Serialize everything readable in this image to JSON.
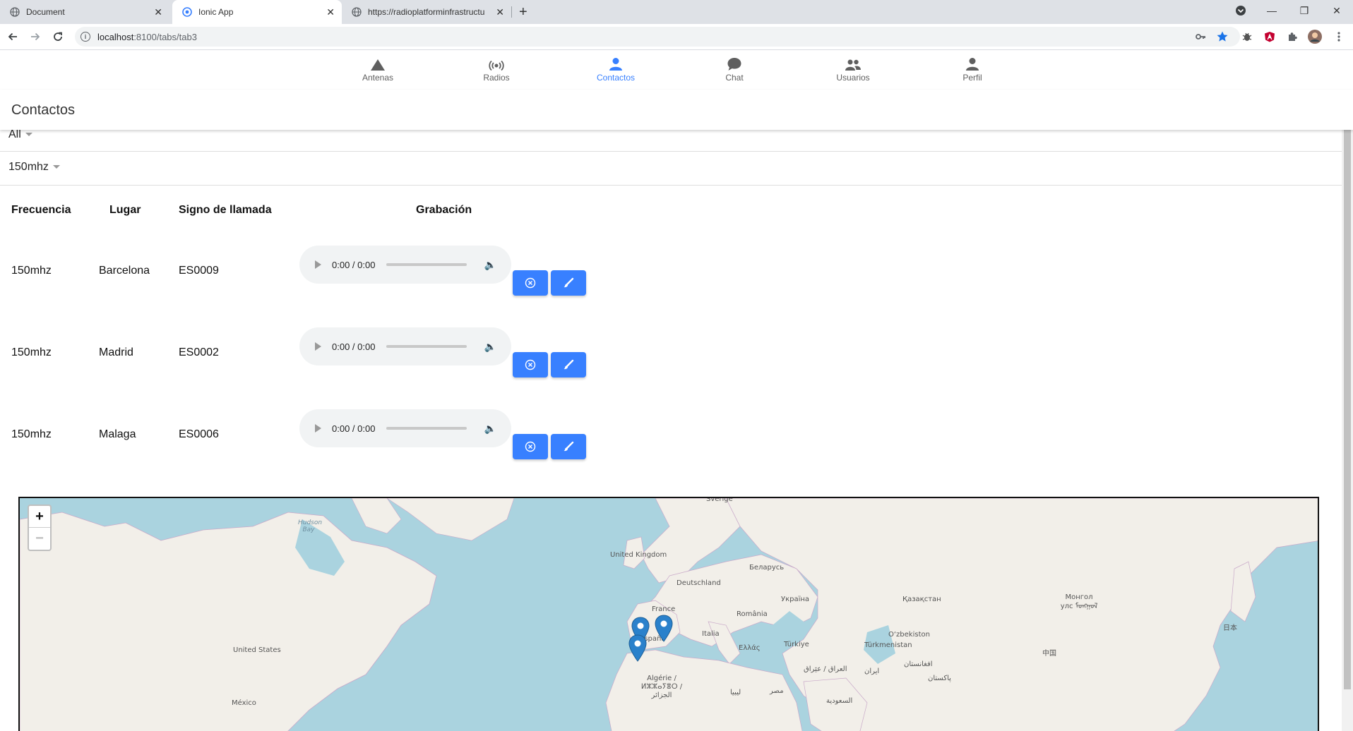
{
  "browser": {
    "tabs": [
      {
        "title": "Document",
        "active": false
      },
      {
        "title": "Ionic App",
        "active": true
      },
      {
        "title": "https://radioplatforminfrastructu",
        "active": false
      }
    ],
    "url_host": "localhost",
    "url_path": ":8100/tabs/tab3"
  },
  "app_tabs": [
    {
      "label": "Antenas",
      "icon": "triangle-icon",
      "selected": false
    },
    {
      "label": "Radios",
      "icon": "radio-icon",
      "selected": false
    },
    {
      "label": "Contactos",
      "icon": "person-icon",
      "selected": true
    },
    {
      "label": "Chat",
      "icon": "chat-icon",
      "selected": false
    },
    {
      "label": "Usuarios",
      "icon": "people-icon",
      "selected": false
    },
    {
      "label": "Perfil",
      "icon": "person-icon",
      "selected": false
    }
  ],
  "header": {
    "title": "Contactos"
  },
  "filters": {
    "first": "All",
    "second": "150mhz"
  },
  "table": {
    "headers": [
      "Frecuencia",
      "Lugar",
      "Signo de llamada",
      "Grabación"
    ],
    "rows": [
      {
        "frecuencia": "150mhz",
        "lugar": "Barcelona",
        "signo": "ES0009",
        "audio_time": "0:00 / 0:00"
      },
      {
        "frecuencia": "150mhz",
        "lugar": "Madrid",
        "signo": "ES0002",
        "audio_time": "0:00 / 0:00"
      },
      {
        "frecuencia": "150mhz",
        "lugar": "Malaga",
        "signo": "ES0006",
        "audio_time": "0:00 / 0:00"
      }
    ]
  },
  "map": {
    "zoom_in": "+",
    "zoom_out": "−",
    "labels": [
      "Sverige",
      "Hudson Bay",
      "United Kingdom",
      "Беларусь",
      "Deutschland",
      "Україна",
      "Қазақстан",
      "Монгол улс ᠮᠣᠩᠭᠣᠯ",
      "France",
      "România",
      "Italia",
      "España",
      "O‘zbekiston",
      "Türkmenistan",
      "Ελλάς",
      "Türkiye",
      "日本",
      "中国",
      "United States",
      "العراق / عێراق",
      "ایران",
      "افغانستان",
      "پاکستان",
      "Algérie / ⵍⵣⵣⴰⵢⴻⵔ / الجزائر",
      "ليبيا",
      "مصر",
      "السعودية",
      "México"
    ],
    "accent": "#3880ff"
  }
}
